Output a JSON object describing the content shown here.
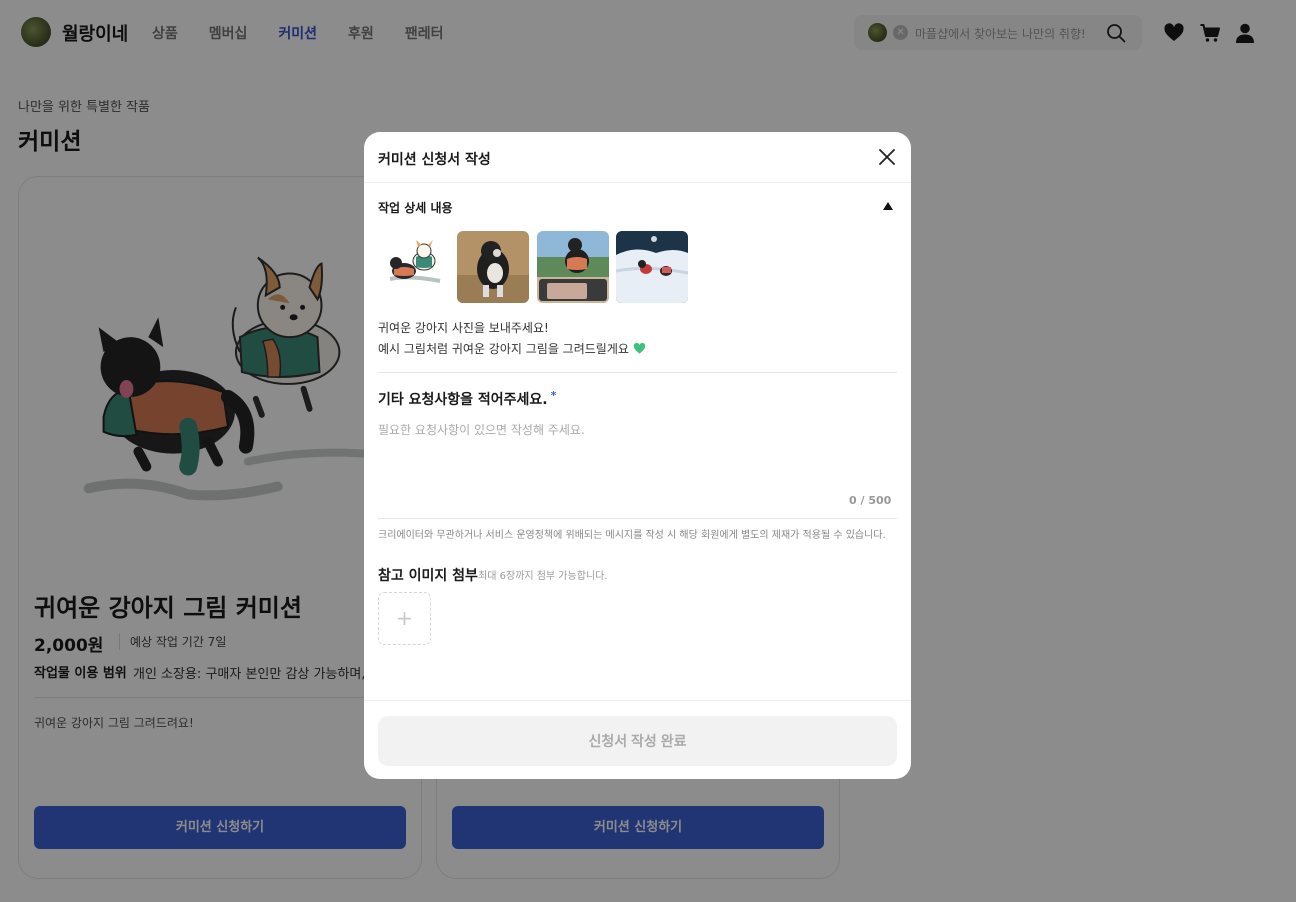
{
  "header": {
    "brand": "월랑이네",
    "nav": [
      "상품",
      "멤버십",
      "커미션",
      "후원",
      "팬레터"
    ],
    "active_nav": "커미션",
    "search_placeholder": "마플샵에서 찾아보는 나만의 취향!"
  },
  "page": {
    "subtitle": "나만을 위한 특별한 작품",
    "title": "커미션"
  },
  "card": {
    "name": "귀여운 강아지 그림 커미션",
    "price": "2,000원",
    "period": "예상 작업 기간 7일",
    "scope_label": "작업물 이용 범위",
    "scope_value": "개인 소장용: 구매자 본인만 감상 가능하며,",
    "description": "귀여운 강아지 그림 그려드려요!",
    "button": "커미션 신청하기"
  },
  "card2": {
    "button": "커미션 신청하기"
  },
  "modal": {
    "title": "커미션 신청서 작성",
    "section_title": "작업 상세 내용",
    "desc_line1": "귀여운 강아지 사진을 보내주세요!",
    "desc_line2": "예시 그림처럼 귀여운 강아지 그림을 그려드릴게요",
    "request_label": "기타 요청사항을 적어주세요.",
    "required_mark": "*",
    "request_placeholder": "필요한 요청사항이 있으면 작성해 주세요.",
    "counter": "0 / 500",
    "notice": "크리에이터와 무관하거나 서비스 운영정책에 위배되는 메시지를 작성 시 해당 회원에게 별도의 제재가 적용될 수 있습니다.",
    "attach_label": "참고 이미지 첨부",
    "attach_hint": "최대 6장까지 첨부 가능합니다.",
    "add_symbol": "+",
    "submit": "신청서 작성 완료"
  },
  "colors": {
    "accent": "#3d5fd4",
    "nav_active": "#3653c9",
    "overlay": "rgba(0,0,0,0.45)",
    "heart_green": "#3cc47c"
  }
}
